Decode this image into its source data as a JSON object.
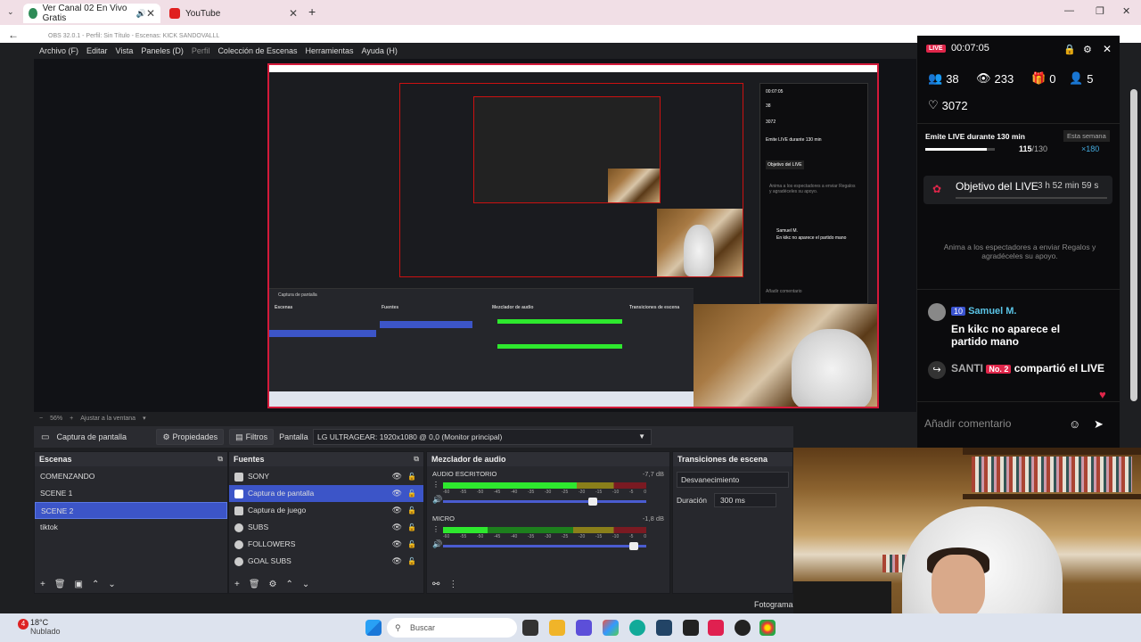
{
  "browser": {
    "tabs": [
      {
        "label": "Ver Canal 02 En Vivo Gratis",
        "active": true
      },
      {
        "label": "YouTube",
        "active": false
      }
    ],
    "new_tab": "+",
    "back": "←"
  },
  "obs": {
    "titlebar": "OBS 32.0.1 - Perfil: Sin Título - Escenas: KICK SANDOVALLL",
    "menu": [
      "Archivo (F)",
      "Editar",
      "Vista",
      "Paneles (D)",
      "Perfil",
      "Colección de Escenas",
      "Herramientas",
      "Ayuda (H)"
    ],
    "zoom": "56%",
    "fit": "Ajustar a la ventana",
    "source_bar": {
      "source": "Captura de pantalla",
      "props": "Propiedades",
      "filters": "Filtros",
      "display_label": "Pantalla",
      "display_value": "LG ULTRAGEAR: 1920x1080 @ 0,0 (Monitor principal)"
    },
    "scenes": {
      "title": "Escenas",
      "items": [
        "COMENZANDO",
        "SCENE 1",
        "SCENE 2",
        "tiktok"
      ],
      "selected": 2
    },
    "sources": {
      "title": "Fuentes",
      "items": [
        "SONY",
        "Captura de pantalla",
        "Captura de juego",
        "SUBS",
        "FOLLOWERS",
        "GOAL SUBS"
      ],
      "selected": 1
    },
    "mixer": {
      "title": "Mezclador de audio",
      "channels": [
        {
          "name": "AUDIO ESCRITORIO",
          "db": "-7,7 dB",
          "level": 0.66,
          "fader": 0.76
        },
        {
          "name": "MICRO",
          "db": "-1,8 dB",
          "level": 0.22,
          "fader": 0.96
        }
      ],
      "scale": [
        "-60",
        "-55",
        "-50",
        "-45",
        "-40",
        "-35",
        "-30",
        "-25",
        "-20",
        "-15",
        "-10",
        "-5",
        "0"
      ]
    },
    "transitions": {
      "title": "Transiciones de escena",
      "value": "Desvanecimiento",
      "duration_label": "Duración",
      "duration_value": "300 ms"
    },
    "fotogramas": "Fotogramas"
  },
  "live": {
    "badge": "LIVE",
    "time": "00:07:05",
    "stats": {
      "users": "38",
      "views": "233",
      "gifts": "0",
      "follows": "5",
      "likes": "3072"
    },
    "emit_label": "Emite LIVE durante 130 min",
    "week": "Esta semana",
    "progress_text": "115",
    "progress_total": "/130",
    "progress": 0.885,
    "reward": "×180",
    "goal_label": "Objetivo del LIVE",
    "goal_time": "3 h 52 min 59 s",
    "empty_text": "Anima a los espectadores a enviar Regalos y agradéceles su apoyo.",
    "chat": [
      {
        "level": "10",
        "user": "Samuel M.",
        "text": "En kikc no aparece el partido mano"
      },
      {
        "user": "SANTI",
        "level": "No. 2",
        "text": "compartió el LIVE"
      }
    ],
    "comment_placeholder": "Añadir comentario"
  },
  "taskbar": {
    "weather_temp": "18°C",
    "weather_desc": "Nublado",
    "weather_badge": "4",
    "search": "Buscar"
  }
}
